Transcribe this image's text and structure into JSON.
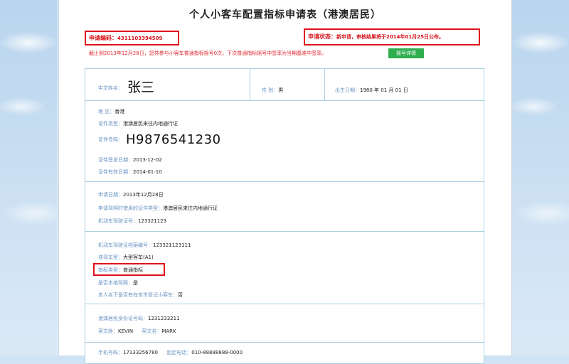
{
  "title": "个人小客车配置指标申请表（港澳居民）",
  "application_no": {
    "label": "申请编码：",
    "value": "4311103394509"
  },
  "status": {
    "label": "申请状态：",
    "value": "新申请，审核结果将于2014年01月25日公布。"
  },
  "notice": "截止到2013年12月28日，您共参与小客车普通指标摇号0次，下次普通指标摇号中签率为当期基准中签率。",
  "detail_button": "摇号详情",
  "name_row": {
    "name_label": "中文姓名：",
    "name_value": "张三",
    "gender_label": "性   别：",
    "gender_value": "男",
    "dob_label": "出生日期：",
    "dob_value": "1980 年 01 月 01 日"
  },
  "identity": {
    "region_label": "地   区：",
    "region_value": "香港",
    "doctype_label": "证件类型：",
    "doctype_value": "港澳居民来往内地通行证",
    "docno_label": "证件号码：",
    "docno_value": "H9876541230",
    "issue_label": "证件签发日期：",
    "issue_value": "2013-12-02",
    "expiry_label": "证件有效日期：",
    "expiry_value": "2014-01-10"
  },
  "application": {
    "date_label": "申请日期：",
    "date_value": "2013年12月28日",
    "apply_doctype_label": "申请驾照时使用的证件类型：",
    "apply_doctype_value": "港澳居民来往内地通行证",
    "license_no_label": "机动车驾驶证号：",
    "license_no_value": "123321123"
  },
  "license": {
    "archive_label": "机动车驾驶证档案编号：",
    "archive_value": "123321123111",
    "class_label": "准驾车型：",
    "class_value": "大型客车(A1)",
    "quota_label": "指标类型：",
    "quota_value": "普通指标",
    "local_label": "是否本地驾照：",
    "local_value": "是",
    "owns_label": "本人名下是否有在本市登记小客车：",
    "owns_value": "否"
  },
  "hk": {
    "hkid_label": "港澳居民身份证号码：",
    "hkid_value": "1231233211",
    "surname_label": "英文姓：",
    "surname_value": "KEVIN",
    "given_label": "英文名：",
    "given_value": "MARK"
  },
  "more": {
    "phone_label": "手机号码：",
    "phone_value": "17133256780",
    "tel_label": "固定电话：",
    "tel_value": "010-88888888-0000"
  }
}
